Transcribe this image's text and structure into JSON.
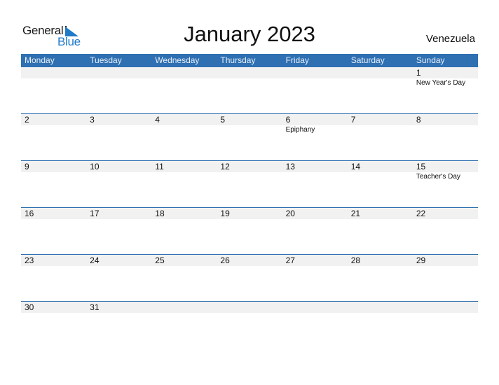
{
  "logo": {
    "general": "General",
    "blue": "Blue",
    "brand_color": "#1f7ac8"
  },
  "title": "January 2023",
  "country": "Venezuela",
  "header_color": "#2e70b2",
  "weekdays": [
    "Monday",
    "Tuesday",
    "Wednesday",
    "Thursday",
    "Friday",
    "Saturday",
    "Sunday"
  ],
  "weeks": [
    [
      {
        "d": "",
        "h": ""
      },
      {
        "d": "",
        "h": ""
      },
      {
        "d": "",
        "h": ""
      },
      {
        "d": "",
        "h": ""
      },
      {
        "d": "",
        "h": ""
      },
      {
        "d": "",
        "h": ""
      },
      {
        "d": "1",
        "h": "New Year's Day"
      }
    ],
    [
      {
        "d": "2",
        "h": ""
      },
      {
        "d": "3",
        "h": ""
      },
      {
        "d": "4",
        "h": ""
      },
      {
        "d": "5",
        "h": ""
      },
      {
        "d": "6",
        "h": "Epiphany"
      },
      {
        "d": "7",
        "h": ""
      },
      {
        "d": "8",
        "h": ""
      }
    ],
    [
      {
        "d": "9",
        "h": ""
      },
      {
        "d": "10",
        "h": ""
      },
      {
        "d": "11",
        "h": ""
      },
      {
        "d": "12",
        "h": ""
      },
      {
        "d": "13",
        "h": ""
      },
      {
        "d": "14",
        "h": ""
      },
      {
        "d": "15",
        "h": "Teacher's Day"
      }
    ],
    [
      {
        "d": "16",
        "h": ""
      },
      {
        "d": "17",
        "h": ""
      },
      {
        "d": "18",
        "h": ""
      },
      {
        "d": "19",
        "h": ""
      },
      {
        "d": "20",
        "h": ""
      },
      {
        "d": "21",
        "h": ""
      },
      {
        "d": "22",
        "h": ""
      }
    ],
    [
      {
        "d": "23",
        "h": ""
      },
      {
        "d": "24",
        "h": ""
      },
      {
        "d": "25",
        "h": ""
      },
      {
        "d": "26",
        "h": ""
      },
      {
        "d": "27",
        "h": ""
      },
      {
        "d": "28",
        "h": ""
      },
      {
        "d": "29",
        "h": ""
      }
    ],
    [
      {
        "d": "30",
        "h": ""
      },
      {
        "d": "31",
        "h": ""
      },
      {
        "d": "",
        "h": ""
      },
      {
        "d": "",
        "h": ""
      },
      {
        "d": "",
        "h": ""
      },
      {
        "d": "",
        "h": ""
      },
      {
        "d": "",
        "h": ""
      }
    ]
  ]
}
